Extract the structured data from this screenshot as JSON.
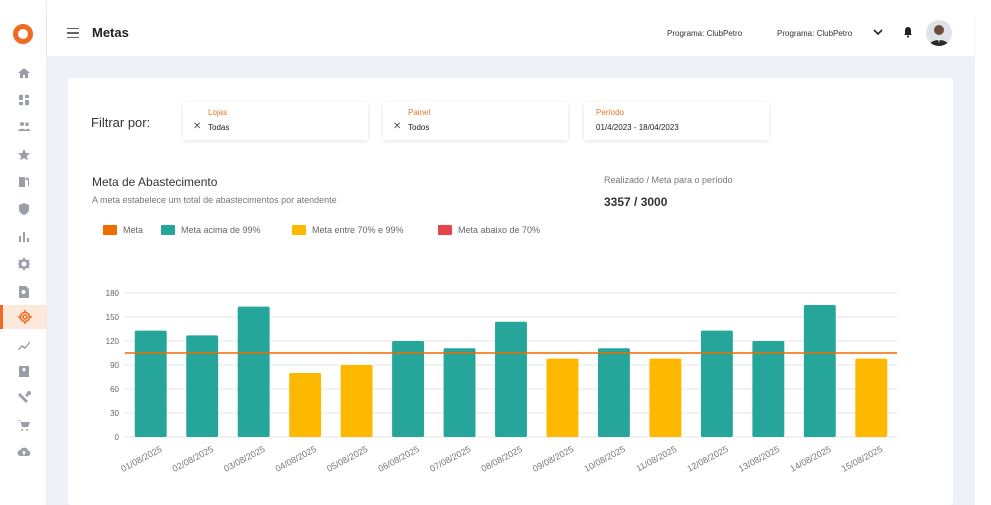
{
  "header": {
    "title": "Metas",
    "program1": "Programa: ClubPetro",
    "program2": "Programa: ClubPetro"
  },
  "sidebar": {
    "items": [
      "home-icon",
      "dashboard-icon",
      "users-icon",
      "star-icon",
      "fuel-icon",
      "shield-icon",
      "bar-chart-icon",
      "settings-icon",
      "search-doc-icon",
      "target-icon",
      "trend-icon",
      "badge-icon",
      "gift-icon",
      "cart-icon",
      "cloud-upload-icon"
    ],
    "active": "target-icon"
  },
  "filters": {
    "label": "Filtrar por:",
    "lojas": {
      "title": "Lojas",
      "value": "Todas"
    },
    "painel": {
      "title": "Painel",
      "value": "Todos"
    },
    "periodo": {
      "title": "Período",
      "value": "01/4/2023 - 18/04/2023"
    }
  },
  "summary": {
    "title": "Meta de Abastecimento",
    "subtitle": "A meta estabelece um total de abastecimentos por atendente",
    "realizado_label": "Realizado / Meta para o período",
    "realizado_value": "3357 / 3000"
  },
  "legend": [
    {
      "label": "Meta",
      "color": "#ef6c00"
    },
    {
      "label": "Meta acima de 99%",
      "color": "#26a69a"
    },
    {
      "label": "Meta entre 70% e 99%",
      "color": "#ffb800"
    },
    {
      "label": "Meta abaixo de 70%",
      "color": "#e8424f"
    }
  ],
  "chart_data": {
    "type": "bar",
    "categories": [
      "01/08/2025",
      "02/08/2025",
      "03/08/2025",
      "04/08/2025",
      "05/08/2025",
      "06/08/2025",
      "07/08/2025",
      "08/08/2025",
      "09/08/2025",
      "10/08/2025",
      "11/08/2025",
      "12/08/2025",
      "13/08/2025",
      "14/08/2025",
      "15/08/2025"
    ],
    "values": [
      133,
      127,
      163,
      80,
      90,
      120,
      111,
      144,
      98,
      111,
      98,
      133,
      120,
      165,
      98
    ],
    "bar_colors": [
      "#26a69a",
      "#26a69a",
      "#26a69a",
      "#ffb800",
      "#ffb800",
      "#26a69a",
      "#26a69a",
      "#26a69a",
      "#ffb800",
      "#26a69a",
      "#ffb800",
      "#26a69a",
      "#26a69a",
      "#26a69a",
      "#ffb800"
    ],
    "target": 105,
    "target_color": "#ef6c00",
    "ylim": [
      0,
      180
    ],
    "yticks": [
      0,
      30,
      60,
      90,
      120,
      150,
      180
    ],
    "grid": true
  }
}
